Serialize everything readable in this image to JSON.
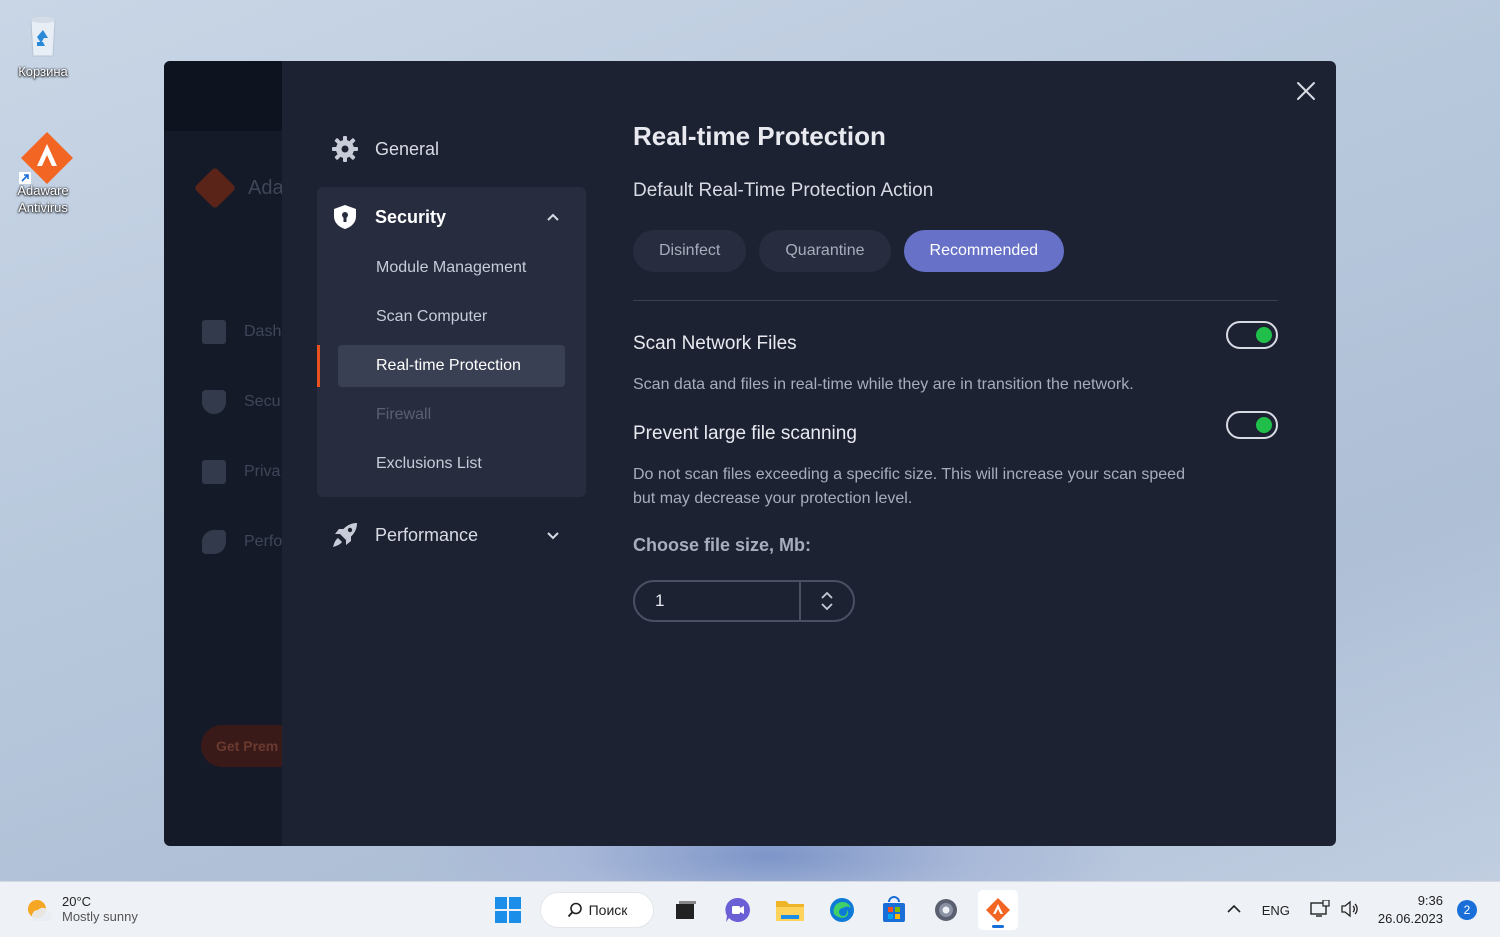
{
  "desktop": {
    "icons": [
      {
        "label": "Корзина"
      },
      {
        "label": "Adaware Antivirus"
      }
    ]
  },
  "background_app": {
    "brand": "Ada",
    "nav": [
      "Dash",
      "Secu",
      "Priva",
      "Perfo"
    ],
    "premium_button": "Get Prem"
  },
  "settings": {
    "nav": {
      "general": "General",
      "security": "Security",
      "security_items": [
        {
          "label": "Module Management",
          "state": "normal"
        },
        {
          "label": "Scan Computer",
          "state": "normal"
        },
        {
          "label": "Real-time Protection",
          "state": "active"
        },
        {
          "label": "Firewall",
          "state": "disabled"
        },
        {
          "label": "Exclusions List",
          "state": "normal"
        }
      ],
      "performance": "Performance"
    },
    "page_title": "Real-time Protection",
    "action_heading": "Default Real-Time Protection Action",
    "actions": [
      {
        "label": "Disinfect",
        "selected": false
      },
      {
        "label": "Quarantine",
        "selected": false
      },
      {
        "label": "Recommended",
        "selected": true
      }
    ],
    "options": [
      {
        "title": "Scan Network Files",
        "description": "Scan data and files in real-time while they are in transition the network.",
        "enabled": true
      },
      {
        "title": "Prevent large file scanning",
        "description": "Do not scan files exceeding a specific size. This will increase your scan speed but may decrease your protection level.",
        "enabled": true
      }
    ],
    "file_size_label": "Choose file size, Mb:",
    "file_size_value": "1"
  },
  "taskbar": {
    "weather_temp": "20°C",
    "weather_desc": "Mostly sunny",
    "search_label": "Поиск",
    "language": "ENG",
    "time": "9:36",
    "date": "26.06.2023",
    "notification_count": "2"
  },
  "colors": {
    "accent": "#6671c7",
    "active_marker": "#e8521f",
    "toggle_on": "#1fbf4a",
    "modal_bg": "#1d2233"
  }
}
